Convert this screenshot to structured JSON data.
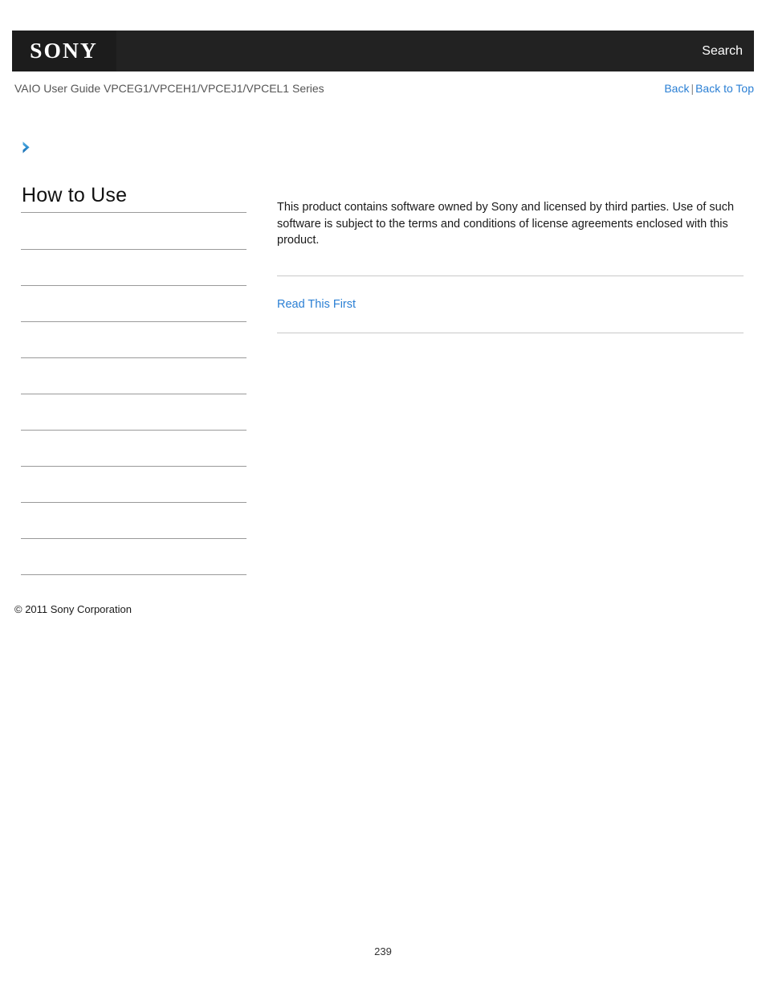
{
  "header": {
    "logo_text": "SONY",
    "search_label": "Search",
    "bar_color": "#222222",
    "logo_box_color": "#1c1c1c"
  },
  "subheader": {
    "guide_title": "VAIO User Guide VPCEG1/VPCEH1/VPCEJ1/VPCEL1 Series",
    "back_label": "Back",
    "separator": "|",
    "back_to_top_label": "Back to Top",
    "link_color": "#2a7fd4"
  },
  "breadcrumb": {
    "icon": "chevron-right-icon",
    "icon_color": "#2a7fd4",
    "text": ""
  },
  "sidebar": {
    "title": "How to Use",
    "items": [
      {
        "label": ""
      },
      {
        "label": ""
      },
      {
        "label": ""
      },
      {
        "label": ""
      },
      {
        "label": ""
      },
      {
        "label": ""
      },
      {
        "label": ""
      },
      {
        "label": ""
      },
      {
        "label": ""
      },
      {
        "label": ""
      }
    ],
    "copyright": "© 2011 Sony Corporation"
  },
  "main": {
    "paragraph": "This product contains software owned by Sony and licensed by third parties. Use of such software is subject to the terms and conditions of license agreements enclosed with this product.",
    "link_label": "Read This First",
    "link_color": "#2a7fd4",
    "rule_color": "#c8c8c8"
  },
  "footer": {
    "page_number": "239"
  }
}
